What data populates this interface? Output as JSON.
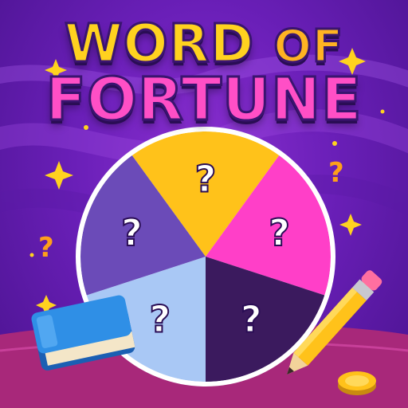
{
  "title": {
    "line1_word1": "WORD",
    "line1_word2": "OF",
    "line2": "FORTUNE"
  },
  "wheel": {
    "segments": [
      {
        "color": "#ffc21a",
        "symbol": "?"
      },
      {
        "color": "#ff3fc8",
        "symbol": "?"
      },
      {
        "color": "#3b1a5e",
        "symbol": "?"
      },
      {
        "color": "#a9c8f5",
        "symbol": "?"
      },
      {
        "color": "#6b4bb8",
        "symbol": "?"
      }
    ]
  },
  "decorations": {
    "sparkle_color": "#ffd21f",
    "question_mark_color": "#ff9f1a",
    "floor_color": "#a8287a"
  },
  "props": [
    "book-icon",
    "pencil-icon",
    "coin-icon"
  ]
}
